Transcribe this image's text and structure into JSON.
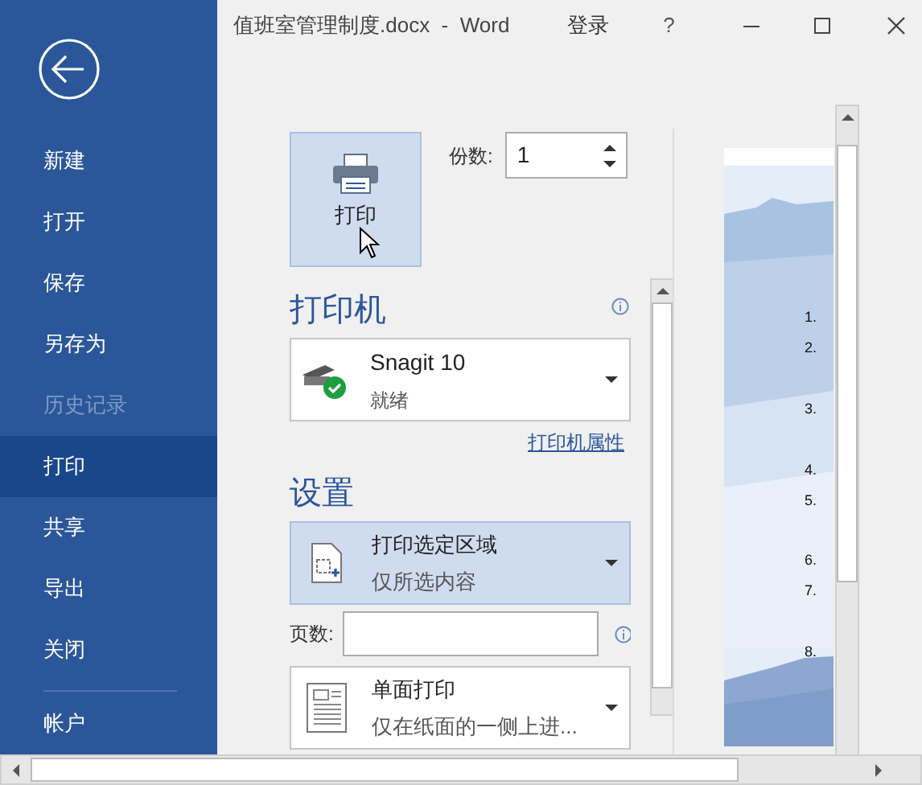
{
  "window": {
    "title": "值班室管理制度.docx  -  Word",
    "sign_in": "登录",
    "help": "?"
  },
  "sidebar": {
    "items": [
      {
        "label": "新建",
        "selected": false,
        "disabled": false
      },
      {
        "label": "打开",
        "selected": false,
        "disabled": false
      },
      {
        "label": "保存",
        "selected": false,
        "disabled": false
      },
      {
        "label": "另存为",
        "selected": false,
        "disabled": false
      },
      {
        "label": "历史记录",
        "selected": false,
        "disabled": true
      },
      {
        "label": "打印",
        "selected": true,
        "disabled": false
      },
      {
        "label": "共享",
        "selected": false,
        "disabled": false
      },
      {
        "label": "导出",
        "selected": false,
        "disabled": false
      },
      {
        "label": "关闭",
        "selected": false,
        "disabled": false
      },
      {
        "label": "帐户",
        "selected": false,
        "disabled": false
      }
    ]
  },
  "print": {
    "button": "打印",
    "copies_label": "份数:",
    "copies_value": "1"
  },
  "printer": {
    "heading": "打印机",
    "name": "Snagit 10",
    "status": "就绪",
    "properties_link": "打印机属性"
  },
  "settings": {
    "heading": "设置",
    "pages_label": "页数:",
    "dropdowns": [
      {
        "kind": "selection",
        "title": "打印选定区域",
        "subtitle": "仅所选内容",
        "highlighted": true
      },
      {
        "kind": "sides",
        "title": "单面打印",
        "subtitle": "仅在纸面的一侧上进...",
        "highlighted": false
      }
    ]
  },
  "preview": {
    "list_numbers": [
      "1.",
      "2.",
      "3.",
      "4.",
      "5.",
      "6.",
      "7.",
      "8."
    ]
  }
}
